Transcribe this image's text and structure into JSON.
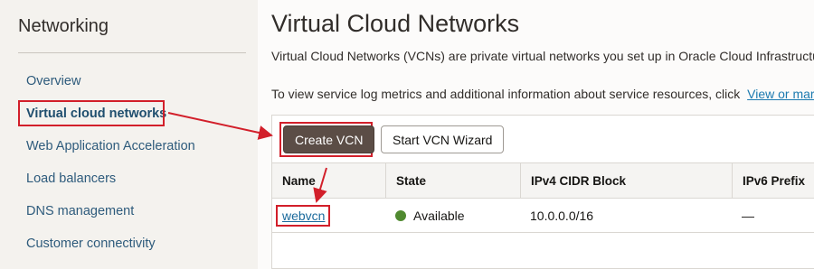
{
  "sidebar": {
    "title": "Networking",
    "items": [
      {
        "label": "Overview"
      },
      {
        "label": "Virtual cloud networks"
      },
      {
        "label": "Web Application Acceleration"
      },
      {
        "label": "Load balancers"
      },
      {
        "label": "DNS management"
      },
      {
        "label": "Customer connectivity"
      }
    ]
  },
  "main": {
    "title": "Virtual Cloud Networks",
    "description": "Virtual Cloud Networks (VCNs) are private virtual networks you set up in Oracle Cloud Infrastructu",
    "info_text": "To view service log metrics and additional information about service resources, click",
    "info_link": "View or mar"
  },
  "toolbar": {
    "create_label": "Create VCN",
    "wizard_label": "Start VCN Wizard"
  },
  "table": {
    "columns": [
      "Name",
      "State",
      "IPv4 CIDR Block",
      "IPv6 Prefix"
    ],
    "rows": [
      {
        "name": "webvcn",
        "state": "Available",
        "ipv4": "10.0.0.0/16",
        "ipv6": "—"
      }
    ]
  },
  "colors": {
    "highlight": "#d21f2a",
    "available": "#508a30",
    "primary_button": "#5b4d46",
    "link": "#1b6a9c"
  }
}
